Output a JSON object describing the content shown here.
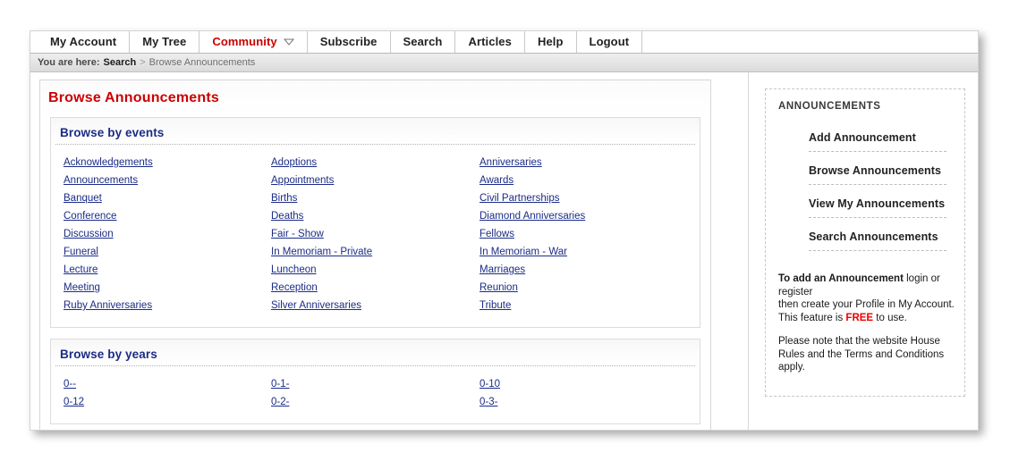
{
  "nav": {
    "items": [
      {
        "label": "My Account",
        "active": false,
        "caret": false
      },
      {
        "label": "My Tree",
        "active": false,
        "caret": false
      },
      {
        "label": "Community",
        "active": true,
        "caret": true
      },
      {
        "label": "Subscribe",
        "active": false,
        "caret": false
      },
      {
        "label": "Search",
        "active": false,
        "caret": false
      },
      {
        "label": "Articles",
        "active": false,
        "caret": false
      },
      {
        "label": "Help",
        "active": false,
        "caret": false
      },
      {
        "label": "Logout",
        "active": false,
        "caret": false
      }
    ]
  },
  "breadcrumb": {
    "prefix": "You are here:",
    "link": "Search",
    "separator": ">",
    "current": "Browse Announcements"
  },
  "page": {
    "title": "Browse Announcements"
  },
  "events_panel": {
    "header": "Browse by events",
    "columns": [
      [
        "Acknowledgements",
        "Announcements",
        "Banquet",
        "Conference",
        "Discussion",
        "Funeral",
        "Lecture",
        "Meeting",
        "Ruby Anniversaries"
      ],
      [
        "Adoptions",
        "Appointments",
        "Births",
        "Deaths",
        "Fair - Show",
        "In Memoriam - Private",
        "Luncheon",
        "Reception",
        "Silver Anniversaries"
      ],
      [
        "Anniversaries",
        "Awards",
        "Civil Partnerships",
        "Diamond Anniversaries",
        "Fellows",
        "In Memoriam - War",
        "Marriages",
        "Reunion",
        "Tribute"
      ]
    ]
  },
  "years_panel": {
    "header": "Browse by years",
    "columns": [
      [
        "0--",
        "0-12"
      ],
      [
        "0-1-",
        "0-2-"
      ],
      [
        "0-10",
        "0-3-"
      ]
    ]
  },
  "sidebar": {
    "title": "ANNOUNCEMENTS",
    "items": [
      "Add Announcement",
      "Browse Announcements",
      "View My Announcements",
      "Search Announcements"
    ],
    "note": {
      "bold_lead": "To add an Announcement",
      "line1_rest": " login or register",
      "line2": "then create your Profile in My Account.",
      "line3_pre": "This feature is ",
      "free": "FREE",
      "line3_post": " to use.",
      "para2": "Please note that the website House Rules and the Terms and Conditions apply."
    }
  },
  "colors": {
    "title_red": "#cc0000",
    "heading_navy": "#1b2c86",
    "link_navy": "#1b2c86",
    "free_red": "#ee0000"
  }
}
